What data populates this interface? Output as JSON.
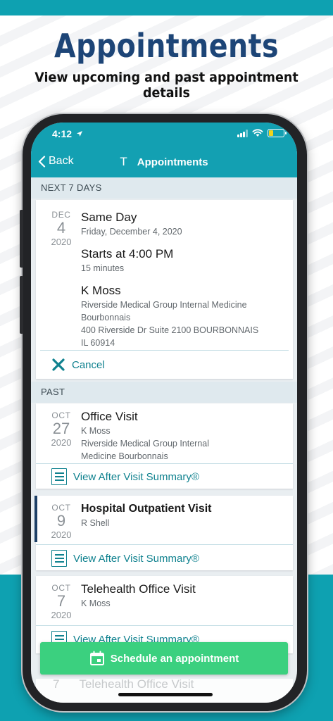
{
  "promo": {
    "title": "Appointments",
    "subtitle": "View upcoming and past appointment details"
  },
  "status_bar": {
    "time": "4:12"
  },
  "nav": {
    "back_label": "Back",
    "title_mark": "T",
    "title": "Appointments"
  },
  "sections": {
    "upcoming": "NEXT 7 DAYS",
    "past": "PAST"
  },
  "upcoming_appointment": {
    "month": "DEC",
    "day": "4",
    "year": "2020",
    "title": "Same Day",
    "date_full": "Friday, December 4, 2020",
    "start": "Starts at 4:00 PM",
    "duration": "15 minutes",
    "provider": "K Moss",
    "location_line1": "Riverside Medical Group Internal Medicine",
    "location_line2": "Bourbonnais",
    "address_line1": "400 Riverside Dr Suite 2100 BOURBONNAIS",
    "address_line2": "IL 60914",
    "cancel_label": "Cancel"
  },
  "past_appointments": [
    {
      "month": "OCT",
      "day": "27",
      "year": "2020",
      "title": "Office Visit",
      "provider": "K Moss",
      "location_line1": "Riverside Medical Group Internal",
      "location_line2": "Medicine Bourbonnais",
      "action": "View After Visit Summary®"
    },
    {
      "month": "OCT",
      "day": "9",
      "year": "2020",
      "title": "Hospital Outpatient Visit",
      "provider": "R Shell",
      "action": "View After Visit Summary®"
    },
    {
      "month": "OCT",
      "day": "7",
      "year": "2020",
      "title": "Telehealth Office Visit",
      "provider": "K Moss",
      "action": "View After Visit Summary®"
    }
  ],
  "schedule_button": {
    "label": "Schedule an appointment"
  },
  "peek": {
    "day": "7",
    "title": "Telehealth Office Visit"
  },
  "colors": {
    "brand_teal": "#13a0b2",
    "title_navy": "#1d4577",
    "action_teal": "#10828f",
    "schedule_green": "#3bd07f",
    "selected_bar": "#1d3f66"
  }
}
